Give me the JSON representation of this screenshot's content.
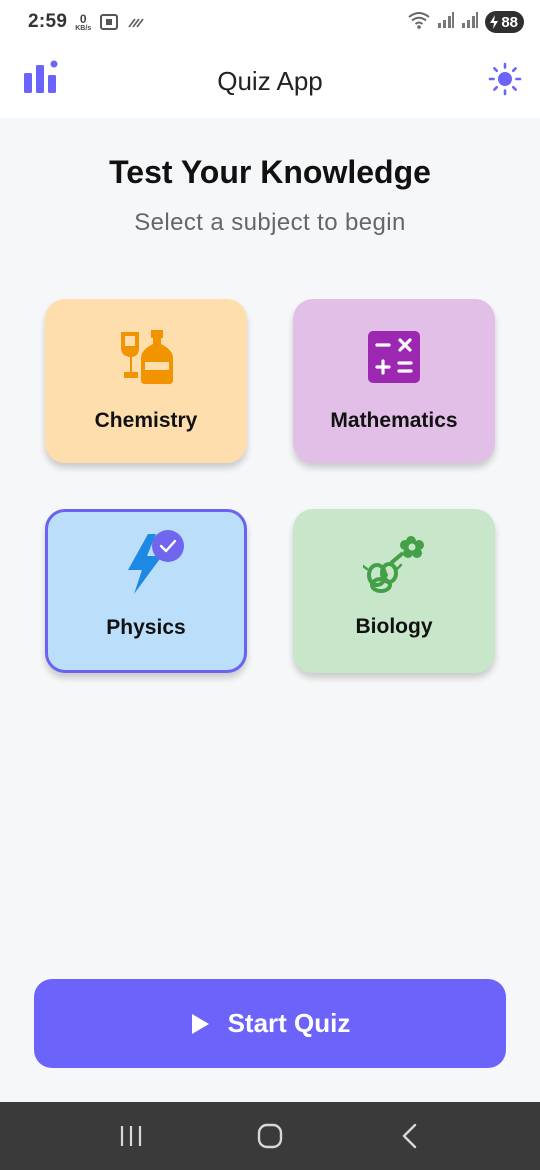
{
  "status_bar": {
    "time": "2:59",
    "net_speed_value": "0",
    "net_speed_unit": "KB/s",
    "battery": "88"
  },
  "app_bar": {
    "title": "Quiz App",
    "left_icon": "bar-chart-icon",
    "right_icon": "sun-icon"
  },
  "main": {
    "headline": "Test Your Knowledge",
    "subtitle": "Select a subject to begin"
  },
  "subjects": [
    {
      "label": "Chemistry",
      "icon": "chemistry-icon",
      "bg": "#ffdead",
      "icon_color": "#f29300",
      "selected": false
    },
    {
      "label": "Mathematics",
      "icon": "calculator-icon",
      "bg": "#e2bfe7",
      "icon_color": "#9c27b0",
      "selected": false
    },
    {
      "label": "Physics",
      "icon": "lightning-icon",
      "bg": "#bbdefb",
      "icon_color": "#1e88e5",
      "selected": true
    },
    {
      "label": "Biology",
      "icon": "flower-icon",
      "bg": "#c8e6c9",
      "icon_color": "#43a047",
      "selected": false
    }
  ],
  "start_button": {
    "label": "Start Quiz",
    "color": "#6c63fb"
  },
  "colors": {
    "accent": "#6c63fb",
    "selected_border": "#6a63f2"
  }
}
